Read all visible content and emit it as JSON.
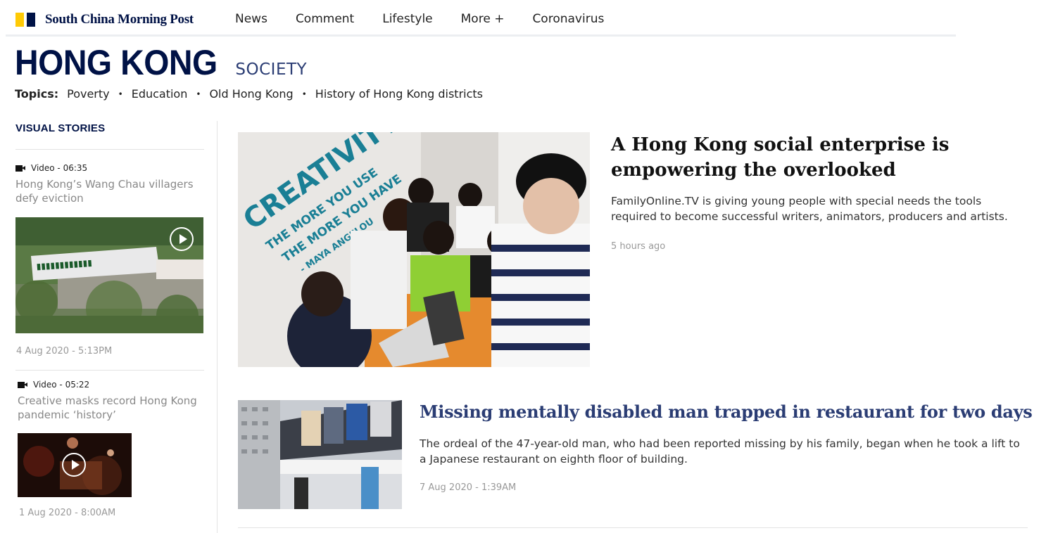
{
  "header": {
    "brand": "South China Morning Post",
    "brand_colors": {
      "yellow": "#ffca05",
      "navy": "#001246"
    },
    "nav": [
      "News",
      "Comment",
      "Lifestyle",
      "More +",
      "Coronavirus"
    ]
  },
  "section": {
    "title": "HONG KONG",
    "subtitle": "SOCIETY",
    "topics_label": "Topics:",
    "topics": [
      "Poverty",
      "Education",
      "Old Hong Kong",
      "History of Hong Kong districts"
    ]
  },
  "sidebar": {
    "title": "VISUAL STORIES",
    "items": [
      {
        "type": "Video - 06:35",
        "headline": "Hong Kong’s Wang Chau villagers defy eviction",
        "date": "4 Aug 2020 - 5:13PM"
      },
      {
        "type": "Video - 05:22",
        "headline": "Creative masks record Hong Kong pandemic ‘history’",
        "date": "1 Aug 2020 - 8:00AM"
      }
    ]
  },
  "lead_story": {
    "title": "A Hong Kong social enterprise is empowering the overlooked",
    "summary": "FamilyOnline.TV is giving young people with special needs the tools required to become successful writers, animators, producers and artists.",
    "time": "5 hours ago",
    "image_wall_text": [
      "CREATIVITY",
      "THE MORE YOU USE",
      "THE MORE YOU HAVE",
      "- MAYA ANGELOU"
    ]
  },
  "second_story": {
    "title": "Missing mentally disabled man trapped in restaurant for two days",
    "summary": "The ordeal of the 47-year-old man, who had been reported missing by his family, began when he took a lift to a Japanese restaurant on eighth floor of building.",
    "time": "7 Aug 2020 - 1:39AM"
  }
}
